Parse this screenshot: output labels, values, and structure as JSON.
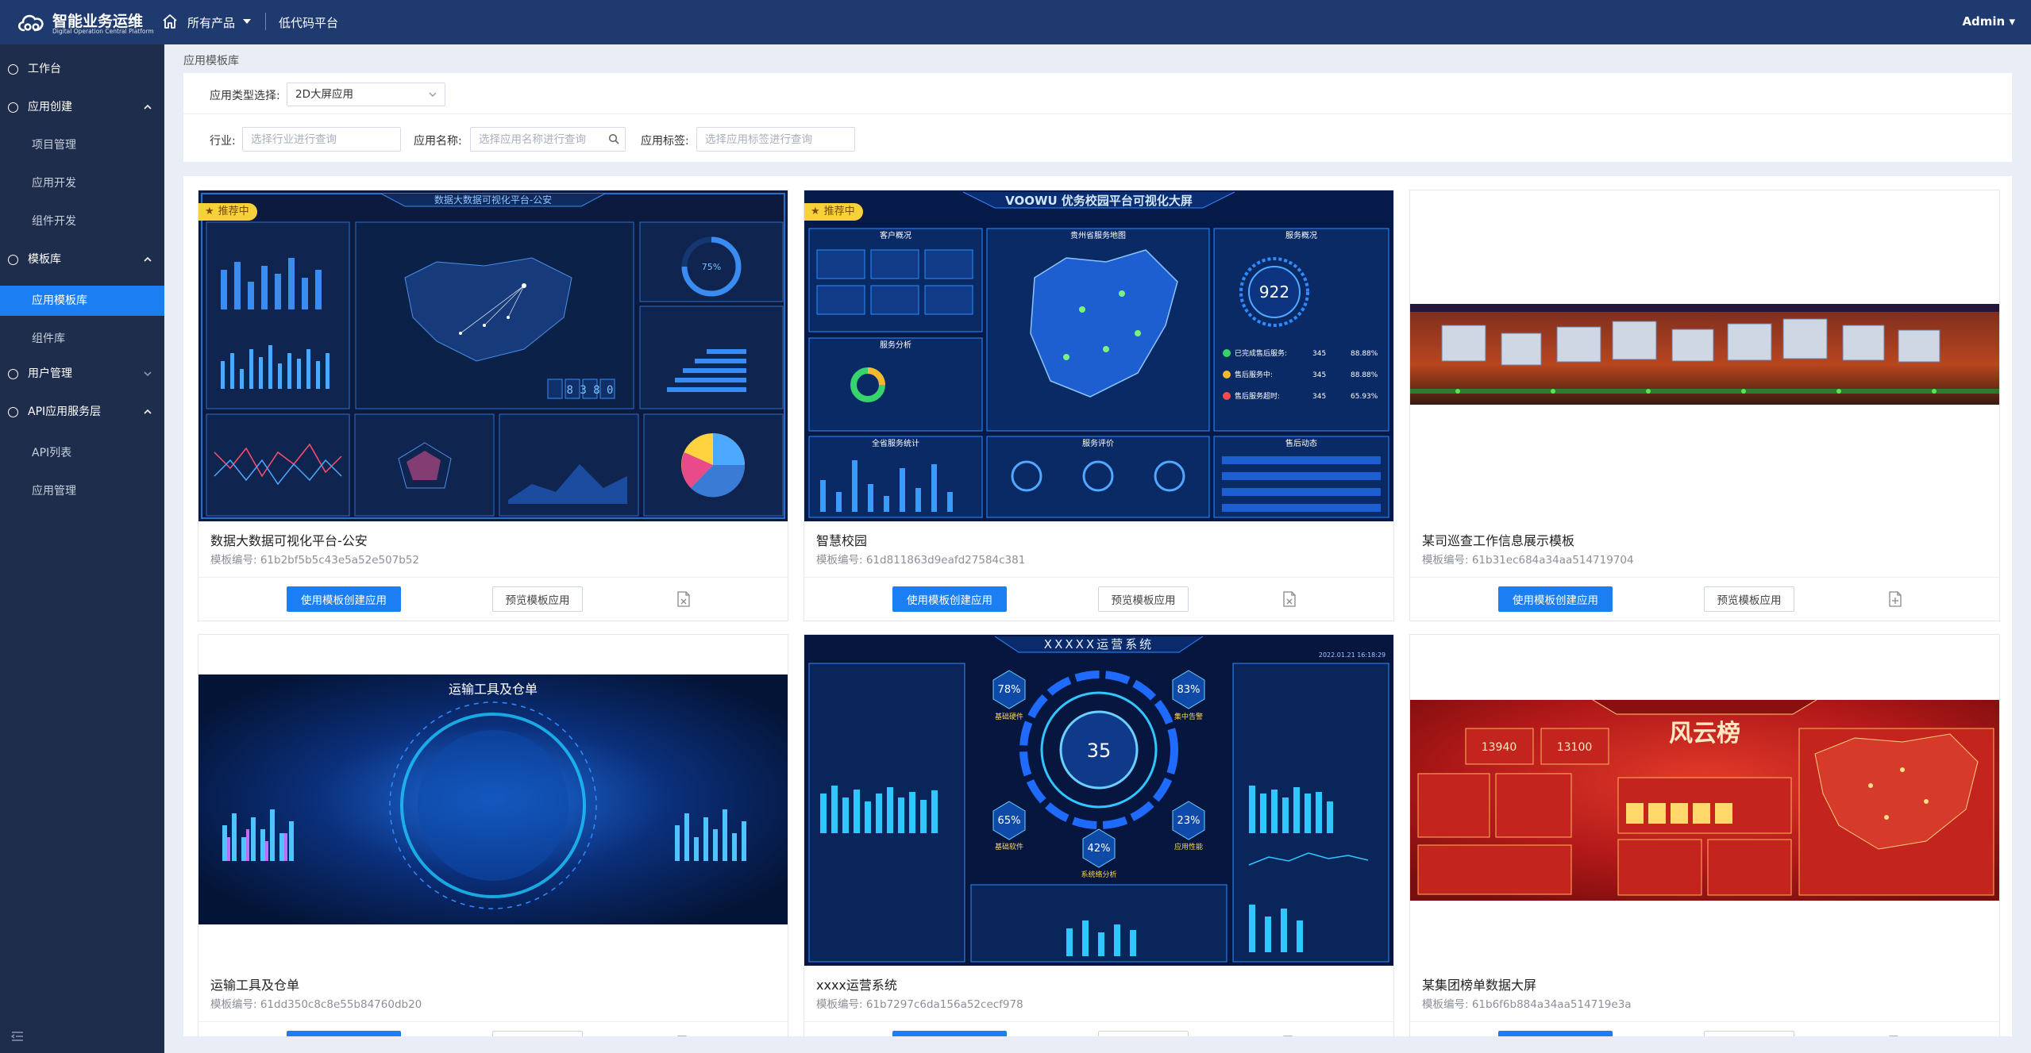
{
  "header": {
    "logo_title": "智能业务运维",
    "logo_subtitle": "Digital Operation Central Platform",
    "nav_products": "所有产品",
    "nav_lowcode": "低代码平台",
    "user": "Admin",
    "colors": {
      "bar": "#1f3a6e",
      "accent": "#1c7ef3"
    }
  },
  "sidebar": {
    "items": [
      {
        "label": "工作台",
        "kind": "group",
        "chevron": ""
      },
      {
        "label": "应用创建",
        "kind": "group",
        "chevron": "up"
      },
      {
        "label": "项目管理",
        "kind": "sub"
      },
      {
        "label": "应用开发",
        "kind": "sub"
      },
      {
        "label": "组件开发",
        "kind": "sub"
      },
      {
        "label": "模板库",
        "kind": "group",
        "chevron": "up"
      },
      {
        "label": "应用模板库",
        "kind": "sub",
        "active": true
      },
      {
        "label": "组件库",
        "kind": "sub"
      },
      {
        "label": "用户管理",
        "kind": "group",
        "chevron": "down"
      },
      {
        "label": "API应用服务层",
        "kind": "group",
        "chevron": "up"
      },
      {
        "label": "API列表",
        "kind": "sub"
      },
      {
        "label": "应用管理",
        "kind": "sub"
      }
    ]
  },
  "breadcrumb": "应用模板库",
  "filters": {
    "type_label": "应用类型选择:",
    "type_value": "2D大屏应用",
    "industry_label": "行业:",
    "industry_placeholder": "选择行业进行查询",
    "name_label": "应用名称:",
    "name_placeholder": "选择应用名称进行查询",
    "tag_label": "应用标签:",
    "tag_placeholder": "选择应用标签进行查询"
  },
  "card_labels": {
    "use_button": "使用模板创建应用",
    "preview_button": "预览模板应用",
    "code_prefix": "模板编号: ",
    "badge": "推荐中"
  },
  "cards": [
    {
      "title": "数据大数据可视化平台-公安",
      "code": "61b2bf5b5c43e5a52e507b52",
      "recommended": true,
      "thumb": {
        "banner": "数据大数据可视化平台-公安",
        "counter": "8 3 8 0",
        "gauge": "75%"
      }
    },
    {
      "title": "智慧校园",
      "code": "61d811863d9eafd27584c381",
      "recommended": true,
      "thumb": {
        "banner": "VOOWU 优务校园平台可视化大屏",
        "panel_left": "客户概况",
        "panel_mid": "贵州省服务地图",
        "panel_right": "服务概况",
        "gauge": "922",
        "stat1": "已完成售后服务:",
        "stat1_value": "345",
        "stat1_pct": "88.88%",
        "stat2": "售后服务中:",
        "stat2_value": "345",
        "stat2_pct": "88.88%",
        "stat3": "售后服务超时:",
        "stat3_value": "345",
        "stat3_pct": "65.93%",
        "panel_a": "服务分析",
        "panel_b": "全省服务统计",
        "panel_c": "服务评价",
        "panel_d": "售后动态"
      }
    },
    {
      "title": "某司巡查工作信息展示模板",
      "code": "61b31ec684a34aa514719704",
      "recommended": false,
      "thumb": {}
    },
    {
      "title": "运输工具及仓单",
      "code": "61dd350c8c8e55b84760db20",
      "recommended": false,
      "thumb": {
        "banner": "运输工具及仓单"
      }
    },
    {
      "title": "xxxx运营系统",
      "code": "61b7297c6da156a52cecf978",
      "recommended": false,
      "thumb": {
        "banner": "XXXXX运营系统",
        "date": "2022.01.21 16:18:29",
        "center": "35",
        "p1": "78%",
        "p1_label": "基础硬件",
        "p2": "83%",
        "p2_label": "集中告警",
        "p3": "65%",
        "p3_label": "基础软件",
        "p4": "23%",
        "p4_label": "应用性能",
        "p5": "42%",
        "p5_label": "系统络分析"
      }
    },
    {
      "title": "某集团榜单数据大屏",
      "code": "61b6f6b884a34aa514719e3a",
      "recommended": false,
      "thumb": {
        "banner": "风云榜",
        "v1": "13940",
        "v2": "13100"
      }
    }
  ]
}
